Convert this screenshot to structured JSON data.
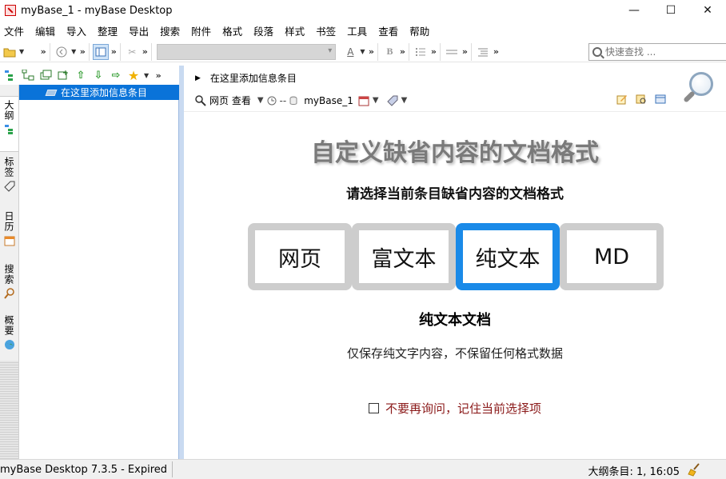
{
  "window": {
    "title": "myBase_1 - myBase Desktop",
    "minimize": "—",
    "maximize": "☐",
    "close": "✕"
  },
  "menu": [
    "文件",
    "编辑",
    "导入",
    "整理",
    "导出",
    "搜索",
    "附件",
    "格式",
    "段落",
    "样式",
    "书签",
    "工具",
    "查看",
    "帮助"
  ],
  "toolbar": {
    "search_placeholder": "快速查找 ...",
    "more": "»",
    "bold": "B",
    "font_color": "A"
  },
  "left_panel": {
    "tabs": [
      "大纲",
      "标签",
      "日历",
      "搜索",
      "概要"
    ],
    "tree": [
      {
        "label": "在这里添加信息条目"
      }
    ]
  },
  "info_bar": {
    "entry_title": "在这里添加信息条目",
    "view_mode": "网页 查看",
    "path_sep": "--",
    "db_name": "myBase_1"
  },
  "content": {
    "title": "自定义缺省内容的文档格式",
    "subtitle": "请选择当前条目缺省内容的文档格式",
    "formats": [
      {
        "label": "网页",
        "selected": false
      },
      {
        "label": "富文本",
        "selected": false
      },
      {
        "label": "纯文本",
        "selected": true
      },
      {
        "label": "MD",
        "selected": false
      }
    ],
    "selected_name": "纯文本文档",
    "selected_desc": "仅保存纯文字内容，不保留任何格式数据",
    "remember_label": "不要再询问，记住当前选择项",
    "remember_checked": false
  },
  "status": {
    "left": "myBase Desktop 7.3.5 - Expired",
    "right": "大纲条目: 1, 16:05"
  },
  "colors": {
    "accent": "#1a8ae8",
    "selection": "#0a73d9",
    "card_border": "#cdcdcd",
    "warning_text": "#8b1a1a"
  }
}
